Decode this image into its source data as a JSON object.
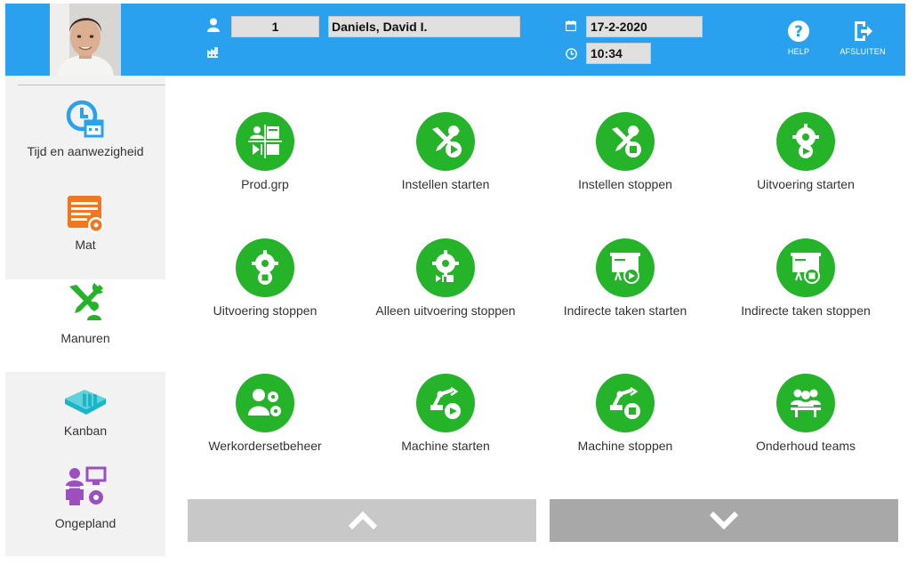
{
  "header": {
    "user_number": "1",
    "user_name": "Daniels, David I.",
    "date": "17-2-2020",
    "time": "10:34",
    "help_label": "HELP",
    "close_label": "AFSLUITEN"
  },
  "sidebar": {
    "items": [
      {
        "label": "Tijd en aanwezigheid",
        "icon": "clock-calendar-icon",
        "color": "#2aa1ee"
      },
      {
        "label": "Mat",
        "icon": "material-rack-icon",
        "color": "#f07622"
      },
      {
        "label": "Manuren",
        "icon": "tools-person-icon",
        "color": "#25b32a",
        "active": true
      },
      {
        "label": "Kanban",
        "icon": "kanban-tray-icon",
        "color": "#1bb6c6"
      },
      {
        "label": "Ongepland",
        "icon": "unplanned-icon",
        "color": "#9b4fc0"
      }
    ]
  },
  "tiles": [
    {
      "label": "Prod.grp",
      "icon": "production-group-icon"
    },
    {
      "label": "Instellen starten",
      "icon": "setup-start-icon"
    },
    {
      "label": "Instellen stoppen",
      "icon": "setup-stop-icon"
    },
    {
      "label": "Uitvoering starten",
      "icon": "execution-start-icon"
    },
    {
      "label": "Uitvoering stoppen",
      "icon": "execution-stop-icon"
    },
    {
      "label": "Alleen uitvoering stoppen",
      "icon": "execution-only-stop-icon"
    },
    {
      "label": "Indirecte taken starten",
      "icon": "indirect-start-icon"
    },
    {
      "label": "Indirecte taken stoppen",
      "icon": "indirect-stop-icon"
    },
    {
      "label": "Werkordersetbeheer",
      "icon": "workorder-set-icon"
    },
    {
      "label": "Machine starten",
      "icon": "machine-start-icon"
    },
    {
      "label": "Machine stoppen",
      "icon": "machine-stop-icon"
    },
    {
      "label": "Onderhoud teams",
      "icon": "teams-icon"
    }
  ],
  "colors": {
    "header": "#2aa1ee",
    "tile": "#25b32a",
    "nav_up": "#c8c8c8",
    "nav_down": "#a8a8a8"
  }
}
